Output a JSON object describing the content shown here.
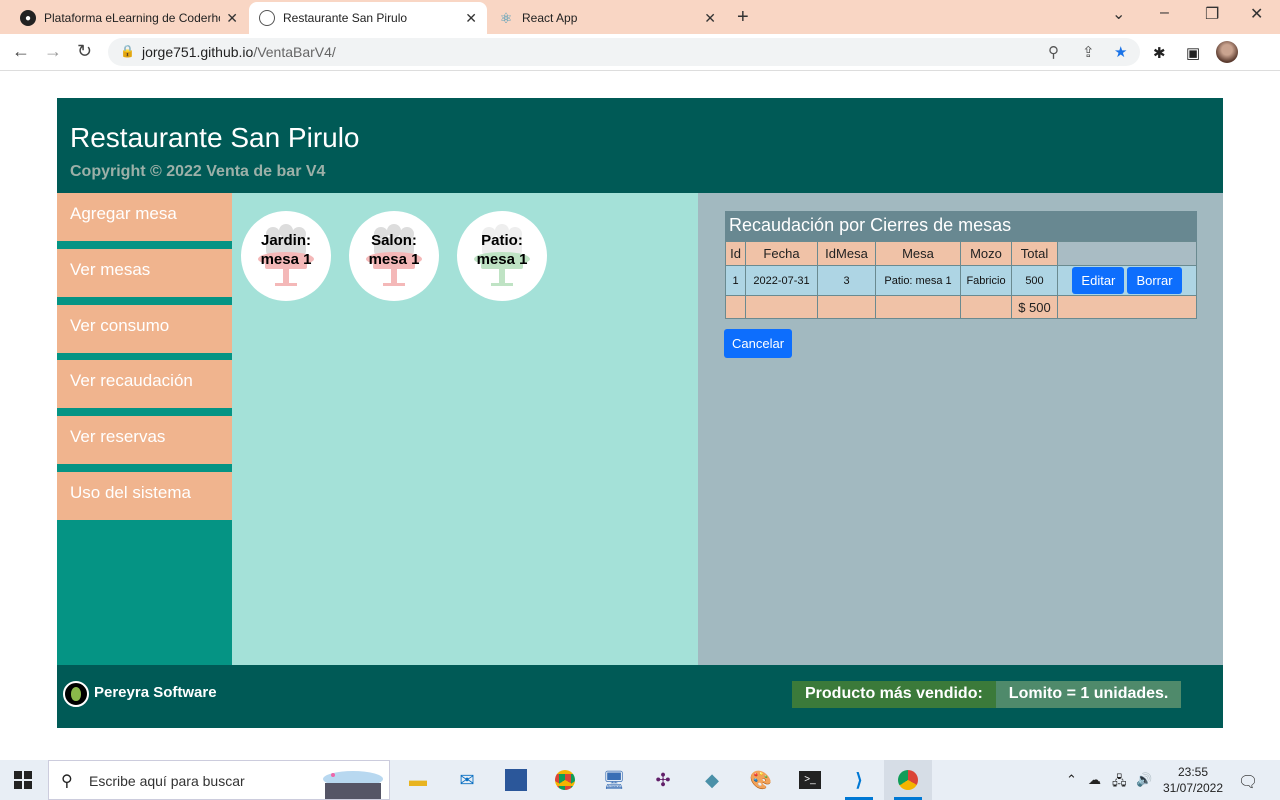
{
  "browser": {
    "tabs": [
      {
        "label": "Plataforma eLearning de Coderho",
        "icon": "coderhouse-icon",
        "active": false
      },
      {
        "label": "Restaurante San Pirulo",
        "icon": "globe-icon",
        "active": true
      },
      {
        "label": "React App",
        "icon": "react-icon",
        "active": false
      }
    ],
    "url_host": "jorge751.github.io",
    "url_path": "/VentaBarV4/"
  },
  "header": {
    "title": "Restaurante San Pirulo",
    "copyright": "Copyright © 2022 Venta de bar V4"
  },
  "sidebar": {
    "items": [
      {
        "label": "Agregar mesa"
      },
      {
        "label": "Ver mesas"
      },
      {
        "label": "Ver consumo"
      },
      {
        "label": "Ver recaudación"
      },
      {
        "label": "Ver reservas"
      },
      {
        "label": "Uso del sistema"
      }
    ]
  },
  "mesas": [
    {
      "line1": "Jardin:",
      "line2": "mesa 1",
      "status_color": "#f4b8b8"
    },
    {
      "line1": "Salon:",
      "line2": "mesa 1",
      "status_color": "#f4b8b8"
    },
    {
      "line1": "Patio:",
      "line2": "mesa 1",
      "status_color": "#bfe3c4"
    }
  ],
  "recaudacion": {
    "title": "Recaudación por Cierres de mesas",
    "headers": [
      "Id",
      "Fecha",
      "IdMesa",
      "Mesa",
      "Mozo",
      "Total"
    ],
    "rows": [
      {
        "id": "1",
        "fecha": "2022-07-31",
        "idmesa": "3",
        "mesa": "Patio: mesa 1",
        "mozo": "Fabricio",
        "total": "500",
        "edit_label": "Editar",
        "delete_label": "Borrar"
      }
    ],
    "sum_total": "$ 500",
    "cancel_label": "Cancelar"
  },
  "footer": {
    "brand": "Pereyra Software",
    "best_label": "Producto más vendido:",
    "best_value": "Lomito = 1 unidades."
  },
  "taskbar": {
    "search_placeholder": "Escribe aquí para buscar",
    "time": "23:55",
    "date": "31/07/2022"
  }
}
